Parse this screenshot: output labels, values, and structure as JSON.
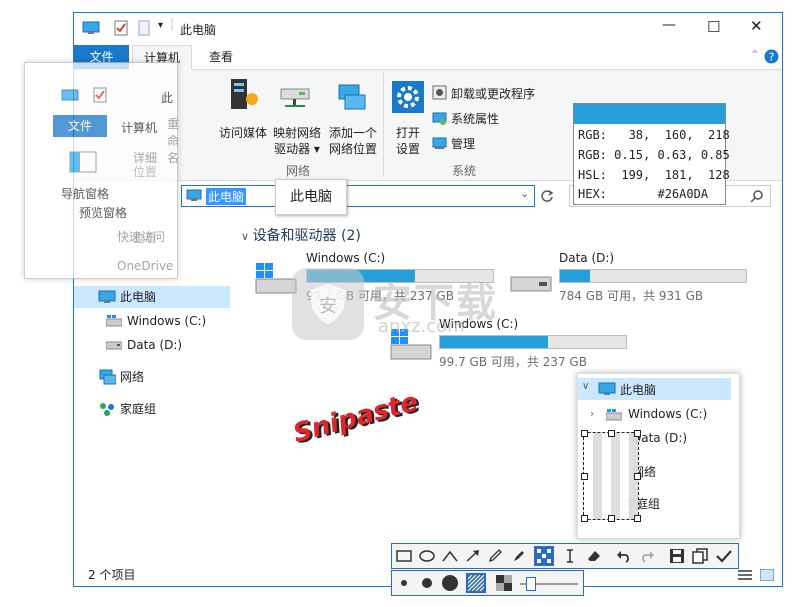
{
  "window": {
    "title": "此电脑",
    "minimize_symbol": "—",
    "maximize_symbol": "☐",
    "close_symbol": "✕"
  },
  "ribbon_tabs": [
    "文件",
    "计算机",
    "查看"
  ],
  "ribbon": {
    "network_group": {
      "label": "网络",
      "access_media": "访问媒体",
      "map_drive_1": "映射网络",
      "map_drive_2": "驱动器 ▾",
      "add_location_1": "添加一个",
      "add_location_2": "网络位置"
    },
    "system_group": {
      "label": "系统",
      "open_settings_1": "打开",
      "open_settings_2": "设置",
      "uninstall": "卸载或更改程序",
      "system_properties": "系统属性",
      "manage": "管理"
    }
  },
  "address": {
    "path": "此电脑",
    "tooltip": "此电脑"
  },
  "color_picker": {
    "swatch": "#26A0DA",
    "rows": [
      "RGB:   38,  160,  218",
      "RGB: 0.15, 0.63, 0.85",
      "HSL:  199,  181,  128",
      "HEX:       #26A0DA"
    ]
  },
  "nav": {
    "items": [
      {
        "label": "此电脑",
        "icon": "computer-icon"
      },
      {
        "label": "Windows (C:)",
        "icon": "windows-drive-icon"
      },
      {
        "label": "Data (D:)",
        "icon": "drive-icon"
      },
      {
        "label": "网络",
        "icon": "network-icon"
      },
      {
        "label": "家庭组",
        "icon": "homegroup-icon"
      }
    ]
  },
  "content": {
    "section_header": "设备和驱动器 (2)",
    "drives": [
      {
        "name": "Windows (C:)",
        "info": "99.7 GB 可用，共 237 GB",
        "used_fraction": 0.58
      },
      {
        "name": "Data (D:)",
        "info": "784 GB 可用，共 931 GB",
        "used_fraction": 0.16
      },
      {
        "name": "Windows (C:)",
        "info": "99.7 GB 可用，共 237 GB",
        "used_fraction": 0.58
      }
    ]
  },
  "overlay": {
    "tabs": [
      "文件",
      "计算机"
    ],
    "address_label": "此",
    "nav_pane": "导航窗格",
    "preview_pane": "预览窗格",
    "details": "详细",
    "position": "位置",
    "rename": "重命名",
    "quick_access": "快速访问",
    "onedrive": "OneDrive",
    "view": "查看"
  },
  "snip_popup": {
    "items": [
      {
        "label": "此电脑"
      },
      {
        "label": "Windows (C:)"
      },
      {
        "label": "Data (D:)"
      },
      {
        "label": "网络"
      },
      {
        "label": "家庭组"
      }
    ]
  },
  "watermark": {
    "brand": "安下载",
    "domain": "anxz.com"
  },
  "snipaste_label": "Snipaste",
  "status": {
    "item_count": "2 个项目"
  },
  "colors": {
    "accent": "#1979ca",
    "drive_fill": "#26a0da",
    "snipaste_red": "#e0262c"
  }
}
